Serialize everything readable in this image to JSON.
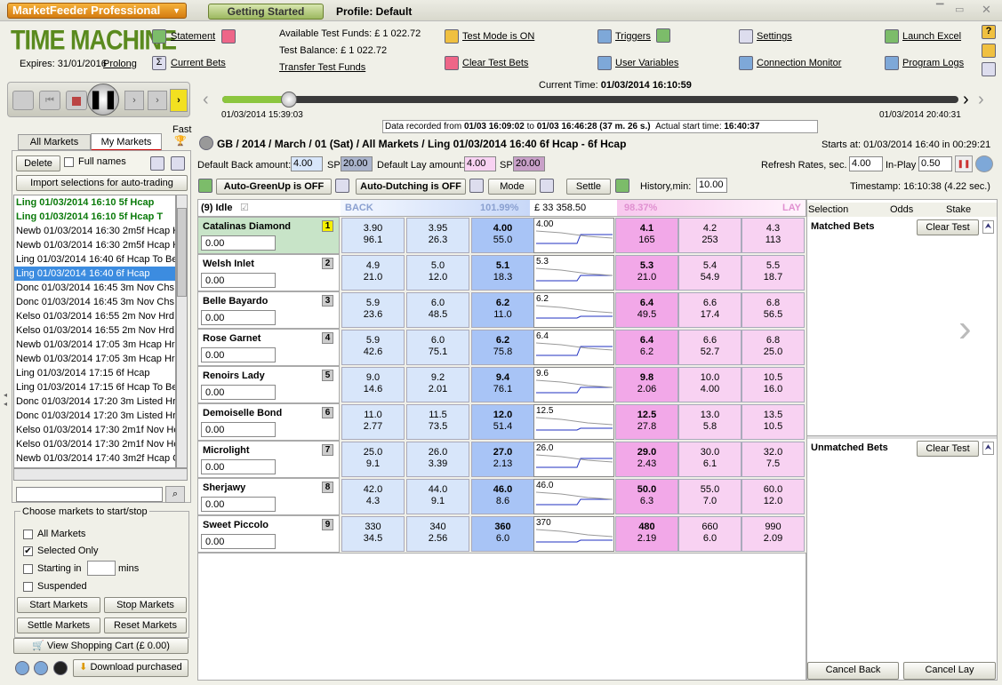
{
  "app": {
    "title": "MarketFeeder Professional",
    "getting_started": "Getting Started",
    "profile": "Profile: Default",
    "brand": "TIME MACHINE",
    "expires": "Expires: 31/01/2016",
    "prolong": "Prolong"
  },
  "toolbar": {
    "statement": "Statement",
    "current_bets": "Current Bets",
    "funds": "Available Test Funds: £ 1 022.72",
    "balance": "Test Balance: £ 1 022.72",
    "transfer": "Transfer Test Funds",
    "test_mode": "Test Mode is ON",
    "clear_test_bets": "Clear Test Bets",
    "triggers": "Triggers",
    "user_variables": "User Variables",
    "settings": "Settings",
    "connection_monitor": "Connection Monitor",
    "launch_excel": "Launch Excel",
    "program_logs": "Program Logs"
  },
  "playback": {
    "current_time_label": "Current Time:",
    "current_time": "01/03/2014 16:10:59",
    "start": "01/03/2014 15:39:03",
    "end": "01/03/2014 20:40:31",
    "progress": 0.09,
    "recorded_label": "Data recorded from",
    "recorded_from": "01/03 16:09:02",
    "to_label": "to",
    "recorded_to": "01/03 16:46:28 (37 m. 26 s.)",
    "actual_label": "Actual start time:",
    "actual_start": "16:40:37",
    "fast": "Fast"
  },
  "left": {
    "tab_all": "All Markets",
    "tab_my": "My Markets",
    "delete": "Delete",
    "full_names": "Full names",
    "import": "Import selections for auto-trading",
    "markets": [
      {
        "t": "Ling 01/03/2014 16:10 5f Hcap",
        "s": "green"
      },
      {
        "t": "Ling 01/03/2014 16:10 5f Hcap T",
        "s": "green"
      },
      {
        "t": "Newb 01/03/2014 16:30 2m5f Hcap H",
        "s": ""
      },
      {
        "t": "Newb 01/03/2014 16:30 2m5f Hcap H",
        "s": ""
      },
      {
        "t": "Ling 01/03/2014 16:40 6f Hcap To Be",
        "s": ""
      },
      {
        "t": "Ling 01/03/2014 16:40 6f Hcap",
        "s": "sel"
      },
      {
        "t": "Donc 01/03/2014 16:45 3m Nov Chs",
        "s": ""
      },
      {
        "t": "Donc 01/03/2014 16:45 3m Nov Chs",
        "s": ""
      },
      {
        "t": "Kelso 01/03/2014 16:55 2m Nov Hrd",
        "s": ""
      },
      {
        "t": "Kelso 01/03/2014 16:55 2m Nov Hrd T",
        "s": ""
      },
      {
        "t": "Newb 01/03/2014 17:05 3m Hcap Hrd",
        "s": ""
      },
      {
        "t": "Newb 01/03/2014 17:05 3m Hcap Hrd",
        "s": ""
      },
      {
        "t": "Ling 01/03/2014 17:15 6f Hcap",
        "s": ""
      },
      {
        "t": "Ling 01/03/2014 17:15 6f Hcap To Be",
        "s": ""
      },
      {
        "t": "Donc 01/03/2014 17:20 3m Listed Hrd",
        "s": ""
      },
      {
        "t": "Donc 01/03/2014 17:20 3m Listed Hrd",
        "s": ""
      },
      {
        "t": "Kelso 01/03/2014 17:30 2m1f Nov Hc",
        "s": ""
      },
      {
        "t": "Kelso 01/03/2014 17:30 2m1f Nov Hc",
        "s": ""
      },
      {
        "t": "Newb 01/03/2014 17:40 3m2f Hcap C",
        "s": ""
      },
      {
        "t": "Newb 01/03/2014 17:40 3m2f Hcap C",
        "s": ""
      }
    ],
    "choose": "Choose markets to start/stop",
    "all_markets": "All Markets",
    "selected_only": "Selected Only",
    "starting_in": "Starting in",
    "mins": "mins",
    "suspended": "Suspended",
    "start_markets": "Start Markets",
    "stop_markets": "Stop Markets",
    "settle_markets": "Settle Markets",
    "reset_markets": "Reset Markets",
    "cart": "View Shopping Cart (£ 0.00)",
    "download": "Download purchased"
  },
  "market": {
    "path": "GB / 2014 / March / 01 (Sat) / All Markets / Ling 01/03/2014 16:40 6f Hcap - 6f Hcap",
    "starts": "Starts at: 01/03/2014 16:40 in 00:29:21",
    "def_back": "Default Back amount:",
    "def_back_val": "4.00",
    "sp": "SP",
    "sp_back": "20.00",
    "def_lay": "Default Lay amount:",
    "def_lay_val": "4.00",
    "sp_lay": "20.00",
    "refresh": "Refresh Rates, sec.",
    "refresh_val": "4.00",
    "inplay": "In-Play",
    "inplay_val": "0.50",
    "autogreen": "Auto-GreenUp is OFF",
    "autodutch": "Auto-Dutching is OFF",
    "mode": "Mode",
    "settle": "Settle",
    "history": "History,min:",
    "history_val": "10.00",
    "timestamp": "Timestamp: 16:10:38 (4.22 sec.)",
    "status": "(9) Idle",
    "back": "BACK",
    "back_pct": "101.99%",
    "matched": "£ 33 358.50",
    "lay_pct": "98.37%",
    "lay": "LAY"
  },
  "runners": [
    {
      "n": "Catalinas Diamond",
      "no": "1",
      "amt": "0.00",
      "b3": [
        "3.90",
        "96.1"
      ],
      "b2": [
        "3.95",
        "26.3"
      ],
      "b1": [
        "4.00",
        "55.0"
      ],
      "ltp": "4.00",
      "l1": [
        "4.1",
        "165"
      ],
      "l2": [
        "4.2",
        "253"
      ],
      "l3": [
        "4.3",
        "113"
      ]
    },
    {
      "n": "Welsh Inlet",
      "no": "2",
      "amt": "0.00",
      "b3": [
        "4.9",
        "21.0"
      ],
      "b2": [
        "5.0",
        "12.0"
      ],
      "b1": [
        "5.1",
        "18.3"
      ],
      "ltp": "5.3",
      "l1": [
        "5.3",
        "21.0"
      ],
      "l2": [
        "5.4",
        "54.9"
      ],
      "l3": [
        "5.5",
        "18.7"
      ]
    },
    {
      "n": "Belle Bayardo",
      "no": "3",
      "amt": "0.00",
      "b3": [
        "5.9",
        "23.6"
      ],
      "b2": [
        "6.0",
        "48.5"
      ],
      "b1": [
        "6.2",
        "11.0"
      ],
      "ltp": "6.2",
      "l1": [
        "6.4",
        "49.5"
      ],
      "l2": [
        "6.6",
        "17.4"
      ],
      "l3": [
        "6.8",
        "56.5"
      ]
    },
    {
      "n": "Rose Garnet",
      "no": "4",
      "amt": "0.00",
      "b3": [
        "5.9",
        "42.6"
      ],
      "b2": [
        "6.0",
        "75.1"
      ],
      "b1": [
        "6.2",
        "75.8"
      ],
      "ltp": "6.4",
      "l1": [
        "6.4",
        "6.2"
      ],
      "l2": [
        "6.6",
        "52.7"
      ],
      "l3": [
        "6.8",
        "25.0"
      ]
    },
    {
      "n": "Renoirs Lady",
      "no": "5",
      "amt": "0.00",
      "b3": [
        "9.0",
        "14.6"
      ],
      "b2": [
        "9.2",
        "2.01"
      ],
      "b1": [
        "9.4",
        "76.1"
      ],
      "ltp": "9.6",
      "l1": [
        "9.8",
        "2.06"
      ],
      "l2": [
        "10.0",
        "4.00"
      ],
      "l3": [
        "10.5",
        "16.0"
      ]
    },
    {
      "n": "Demoiselle Bond",
      "no": "6",
      "amt": "0.00",
      "b3": [
        "11.0",
        "2.77"
      ],
      "b2": [
        "11.5",
        "73.5"
      ],
      "b1": [
        "12.0",
        "51.4"
      ],
      "ltp": "12.5",
      "l1": [
        "12.5",
        "27.8"
      ],
      "l2": [
        "13.0",
        "5.8"
      ],
      "l3": [
        "13.5",
        "10.5"
      ]
    },
    {
      "n": "Microlight",
      "no": "7",
      "amt": "0.00",
      "b3": [
        "25.0",
        "9.1"
      ],
      "b2": [
        "26.0",
        "3.39"
      ],
      "b1": [
        "27.0",
        "2.13"
      ],
      "ltp": "26.0",
      "l1": [
        "29.0",
        "2.43"
      ],
      "l2": [
        "30.0",
        "6.1"
      ],
      "l3": [
        "32.0",
        "7.5"
      ]
    },
    {
      "n": "Sherjawy",
      "no": "8",
      "amt": "0.00",
      "b3": [
        "42.0",
        "4.3"
      ],
      "b2": [
        "44.0",
        "9.1"
      ],
      "b1": [
        "46.0",
        "8.6"
      ],
      "ltp": "46.0",
      "l1": [
        "50.0",
        "6.3"
      ],
      "l2": [
        "55.0",
        "7.0"
      ],
      "l3": [
        "60.0",
        "12.0"
      ]
    },
    {
      "n": "Sweet Piccolo",
      "no": "9",
      "amt": "0.00",
      "b3": [
        "330",
        "34.5"
      ],
      "b2": [
        "340",
        "2.56"
      ],
      "b1": [
        "360",
        "6.0"
      ],
      "ltp": "370",
      "l1": [
        "480",
        "2.19"
      ],
      "l2": [
        "660",
        "6.0"
      ],
      "l3": [
        "990",
        "2.09"
      ]
    }
  ],
  "bets": {
    "col_selection": "Selection",
    "col_odds": "Odds",
    "col_stake": "Stake",
    "matched": "Matched Bets",
    "unmatched": "Unmatched Bets",
    "clear": "Clear Test",
    "cancel_back": "Cancel Back",
    "cancel_lay": "Cancel Lay"
  }
}
